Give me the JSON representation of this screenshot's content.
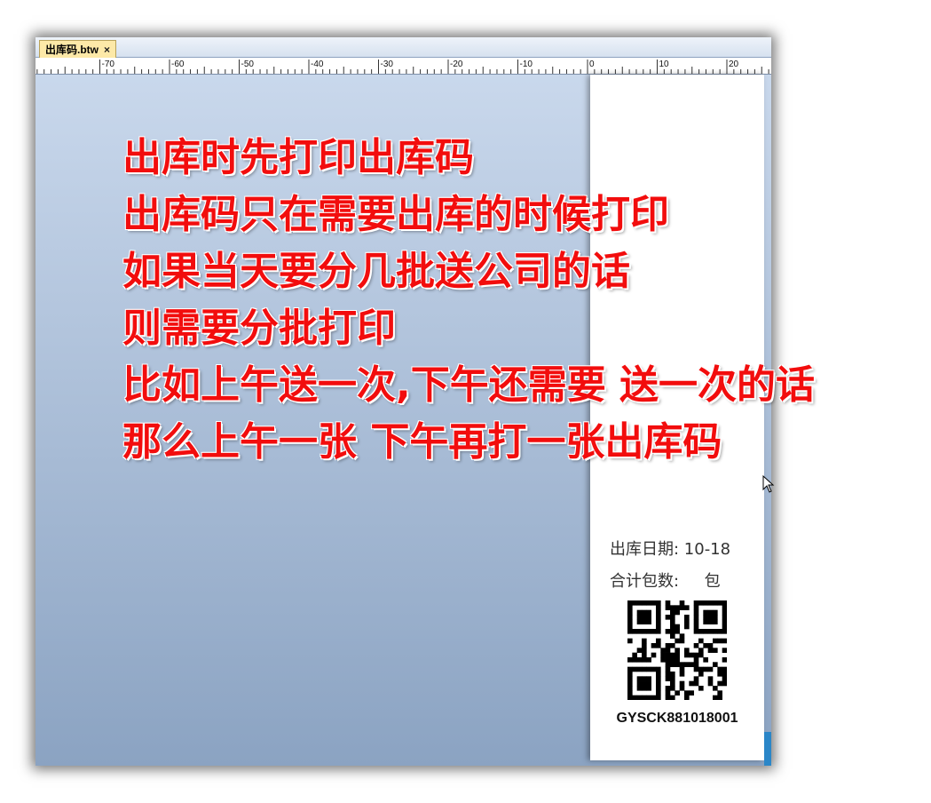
{
  "document_tab": {
    "title": "出库码.btw",
    "close_glyph": "×"
  },
  "ruler": {
    "labels": [
      "-70",
      "-60",
      "-50",
      "-40",
      "-30",
      "-20",
      "-10",
      "0",
      "10",
      "20"
    ]
  },
  "label": {
    "date_label": "出库日期: 10-18",
    "count_label": "合计包数:     包",
    "code": "GYSCK881018001"
  },
  "overlay_lines": [
    "出库时先打印出库码",
    "出库码只在需要出库的时候打印",
    "如果当天要分几批送公司的话",
    "则需要分批打印",
    "比如上午送一次,下午还需要 送一次的话",
    "那么上午一张  下午再打一张出库码"
  ],
  "colors": {
    "overlay_text": "#f20d0d",
    "tab_active": "#fde9a8",
    "canvas_top": "#c9d8ec",
    "canvas_bottom": "#8ba3c2"
  },
  "icons": {
    "cursor": "arrow-cursor-icon",
    "qr": "qr-code-icon"
  }
}
